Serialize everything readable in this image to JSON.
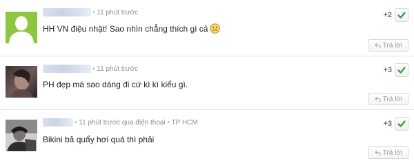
{
  "comments": [
    {
      "time": "11 phút trước",
      "text": "HH VN điệu nhật! Sao nhìn chẳng thích gì cả",
      "emoji_icon": "frowning-face-emoji-icon",
      "votes": "+2",
      "reply_label": "Trả lời",
      "avatar_icon": "default-user-silhouette-icon",
      "avatar_color": "#8dc63f"
    },
    {
      "time": "11 phút trước",
      "text": "PH đẹp mà sao dáng đi cứ kì kì kiểu gì.",
      "votes": "+3",
      "reply_label": "Trả lời",
      "avatar_icon": "user-photo-avatar"
    },
    {
      "time": "11 phút trước qua điện thoại",
      "location": "TP HCM",
      "text": "Bikini bả quẩy hơi quá thì phải",
      "votes": "+3",
      "reply_label": "Trả lời",
      "avatar_icon": "user-photo-avatar"
    }
  ],
  "colors": {
    "accent_check": "#2e9a3a",
    "border": "#e4e4e4",
    "meta": "#8e8e8e"
  }
}
